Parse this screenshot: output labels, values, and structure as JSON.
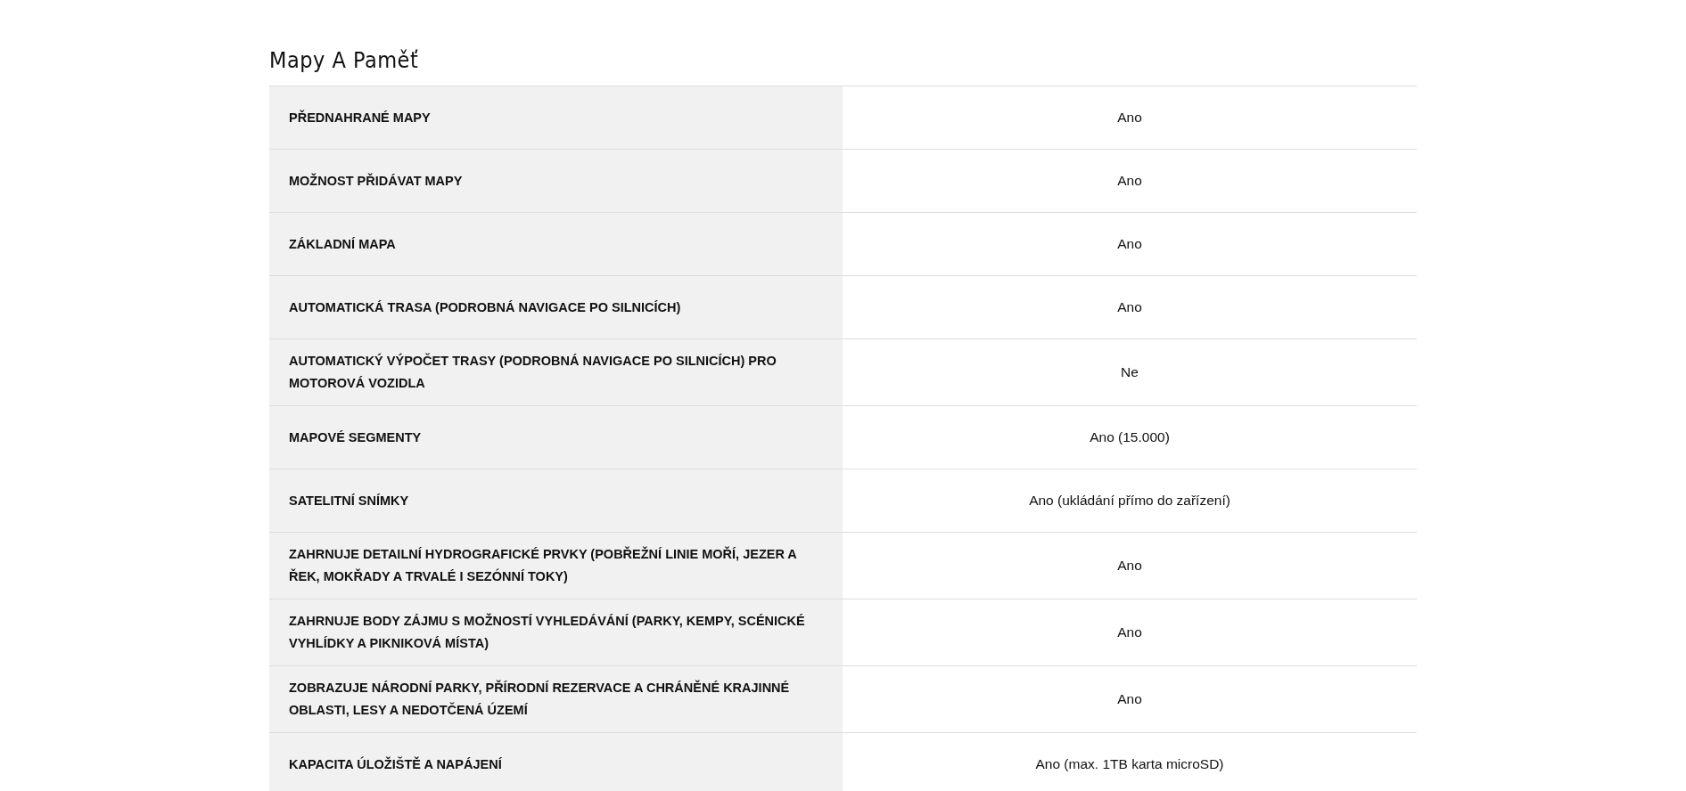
{
  "section": {
    "title": "Mapy A Paměť",
    "rows": [
      {
        "label": "PŘEDNAHRANÉ MAPY",
        "value": "Ano"
      },
      {
        "label": "MOŽNOST PŘIDÁVAT MAPY",
        "value": "Ano"
      },
      {
        "label": "ZÁKLADNÍ MAPA",
        "value": "Ano"
      },
      {
        "label": "AUTOMATICKÁ TRASA (PODROBNÁ NAVIGACE PO SILNICÍCH)",
        "value": "Ano"
      },
      {
        "label": "AUTOMATICKÝ VÝPOČET TRASY (PODROBNÁ NAVIGACE PO SILNICÍCH) PRO MOTOROVÁ VOZIDLA",
        "value": "Ne"
      },
      {
        "label": "MAPOVÉ SEGMENTY",
        "value": "Ano (15.000)"
      },
      {
        "label": "SATELITNÍ SNÍMKY",
        "value": "Ano (ukládání přímo do zařízení)"
      },
      {
        "label": "ZAHRNUJE DETAILNÍ HYDROGRAFICKÉ PRVKY (POBŘEŽNÍ LINIE MOŘÍ, JEZER A ŘEK, MOKŘADY A TRVALÉ I SEZÓNNÍ TOKY)",
        "value": "Ano"
      },
      {
        "label": "ZAHRNUJE BODY ZÁJMU S MOŽNOSTÍ VYHLEDÁVÁNÍ (PARKY, KEMPY, SCÉNICKÉ VYHLÍDKY A PIKNIKOVÁ MÍSTA)",
        "value": "Ano"
      },
      {
        "label": "ZOBRAZUJE NÁRODNÍ PARKY, PŘÍRODNÍ REZERVACE A CHRÁNĚNÉ KRAJINNÉ OBLASTI, LESY A NEDOTČENÁ ÚZEMÍ",
        "value": "Ano"
      },
      {
        "label": "KAPACITA ÚLOŽIŠTĚ A NAPÁJENÍ",
        "value": "Ano (max. 1TB karta microSD)"
      }
    ]
  }
}
